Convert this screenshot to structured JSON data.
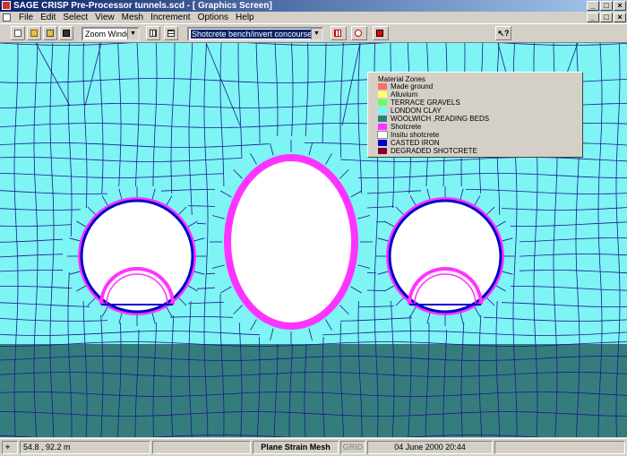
{
  "window": {
    "title": "SAGE CRISP Pre-Processor tunnels.scd - [ Graphics Screen]"
  },
  "menu": [
    "File",
    "Edit",
    "Select",
    "View",
    "Mesh",
    "Increment",
    "Options",
    "Help"
  ],
  "toolbar": {
    "zoom_value": "Zoom Window",
    "zone_value": "Shotcrete bench/invert concourse tunnel"
  },
  "legend": {
    "title": "Material Zones",
    "items": [
      {
        "label": "Made ground",
        "color": "#ff6b6b"
      },
      {
        "label": "Alluvium",
        "color": "#ffff66"
      },
      {
        "label": "TERRACE GRAVELS",
        "color": "#66ff66"
      },
      {
        "label": "LONDON CLAY",
        "color": "#66ffff"
      },
      {
        "label": "WOOLWICH ,READING BEDS",
        "color": "#2e7d7d"
      },
      {
        "label": "Shotcrete",
        "color": "#ff33ff"
      },
      {
        "label": "Insitu shotcrete",
        "color": "#ffffff"
      },
      {
        "label": "CASTED IRON",
        "color": "#0000cc"
      },
      {
        "label": "DEGRADED SHOTCRETE",
        "color": "#800030"
      }
    ]
  },
  "status": {
    "coords": "54.8 , 92.2 m",
    "mode": "Plane Strain Mesh",
    "grid": "GRID",
    "datetime": "04 June 2000 20:44"
  },
  "colors": {
    "london_clay": "#7ef4f4",
    "woolwich": "#357d7d",
    "mesh_line": "#1a1a8c",
    "shotcrete": "#ff33ff",
    "cast_iron": "#0000cc",
    "tunnel_void": "#ffffff"
  }
}
